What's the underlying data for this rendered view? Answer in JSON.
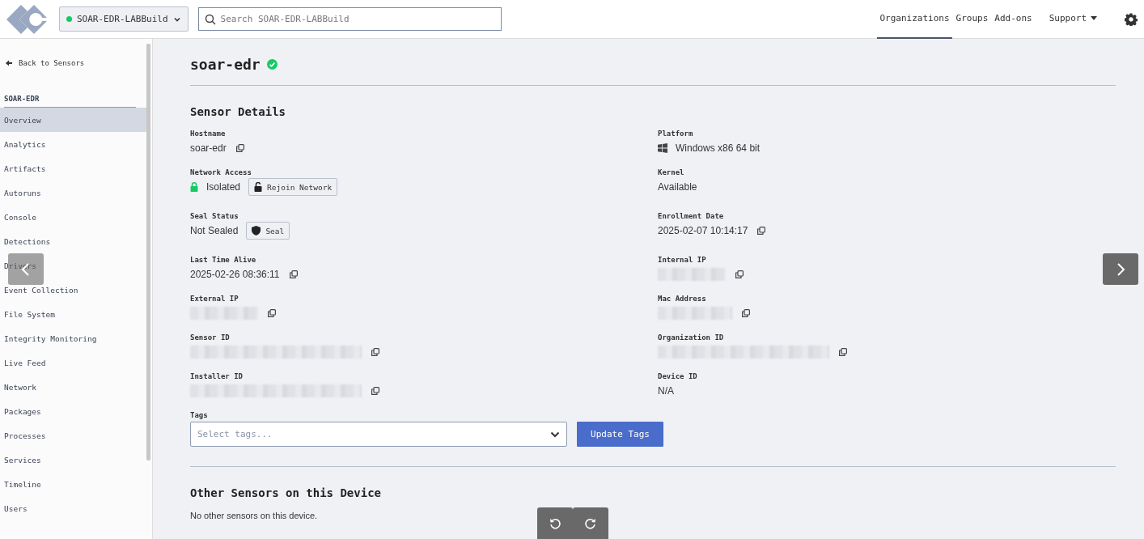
{
  "header": {
    "org_selector": {
      "label": "SOAR-EDR-LABBuild",
      "online": true
    },
    "search": {
      "placeholder": "Search SOAR-EDR-LABBuild"
    },
    "nav": [
      {
        "label": "Organizations",
        "selected": true,
        "kind": "link"
      },
      {
        "label": "Groups",
        "selected": false,
        "kind": "link"
      },
      {
        "label": "Add-ons",
        "selected": false,
        "kind": "link"
      },
      {
        "label": "Support",
        "selected": false,
        "kind": "dropdown"
      }
    ]
  },
  "sidebar": {
    "back_link": "Back to Sensors",
    "section_title": "SOAR-EDR",
    "items": [
      {
        "label": "Overview",
        "selected": true
      },
      {
        "label": "Analytics",
        "selected": false
      },
      {
        "label": "Artifacts",
        "selected": false
      },
      {
        "label": "Autoruns",
        "selected": false
      },
      {
        "label": "Console",
        "selected": false
      },
      {
        "label": "Detections",
        "selected": false
      },
      {
        "label": "Drivers",
        "selected": false
      },
      {
        "label": "Event Collection",
        "selected": false
      },
      {
        "label": "File System",
        "selected": false
      },
      {
        "label": "Integrity Monitoring",
        "selected": false
      },
      {
        "label": "Live Feed",
        "selected": false
      },
      {
        "label": "Network",
        "selected": false
      },
      {
        "label": "Packages",
        "selected": false
      },
      {
        "label": "Processes",
        "selected": false
      },
      {
        "label": "Services",
        "selected": false
      },
      {
        "label": "Timeline",
        "selected": false
      },
      {
        "label": "Users",
        "selected": false
      }
    ]
  },
  "sensor": {
    "name": "soar-edr",
    "online": true
  },
  "sensor_details": {
    "title": "Sensor Details",
    "left": [
      {
        "label": "Hostname",
        "kind": "text",
        "value": "soar-edr",
        "copyable": true
      },
      {
        "label": "Network Access",
        "kind": "network",
        "value": "Isolated",
        "button": "Rejoin Network"
      },
      {
        "label": "Seal Status",
        "kind": "seal",
        "value": "Not Sealed",
        "button": "Seal"
      },
      {
        "label": "Last Time Alive",
        "kind": "text",
        "value": "2025-02-26 08:36:11",
        "copyable": true
      },
      {
        "label": "External IP",
        "kind": "redacted",
        "copyable": true
      },
      {
        "label": "Sensor ID",
        "kind": "redacted",
        "copyable": true
      },
      {
        "label": "Installer ID",
        "kind": "redacted",
        "copyable": true
      }
    ],
    "right": [
      {
        "label": "Platform",
        "kind": "platform",
        "value": "Windows x86 64 bit",
        "copyable": false
      },
      {
        "label": "Kernel",
        "kind": "text",
        "value": "Available",
        "copyable": false
      },
      {
        "label": "Enrollment Date",
        "kind": "text",
        "value": "2025-02-07 10:14:17",
        "copyable": true
      },
      {
        "label": "Internal IP",
        "kind": "redacted",
        "copyable": true
      },
      {
        "label": "Mac Address",
        "kind": "redacted",
        "copyable": true
      },
      {
        "label": "Organization ID",
        "kind": "redacted",
        "copyable": true
      },
      {
        "label": "Device ID",
        "kind": "text",
        "value": "N/A",
        "copyable": false
      }
    ],
    "tags": {
      "label": "Tags",
      "placeholder": "Select tags...",
      "button": "Update Tags"
    }
  },
  "other_sensors": {
    "title": "Other Sensors on this Device",
    "message": "No other sensors on this device."
  },
  "viewer_controls": {
    "previous": true,
    "next": true,
    "rotate": true
  }
}
